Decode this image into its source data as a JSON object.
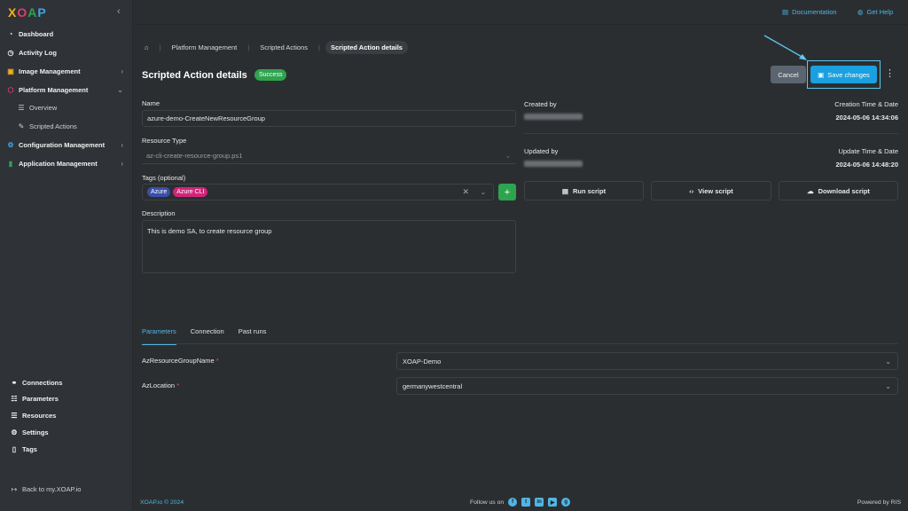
{
  "app": {
    "logo_text": "XOAP"
  },
  "topbar": {
    "documentation": "Documentation",
    "get_help": "Get Help"
  },
  "sidebar": {
    "items": [
      {
        "label": "Dashboard",
        "icon": "dashboard-icon"
      },
      {
        "label": "Activity Log",
        "icon": "clock-icon"
      },
      {
        "label": "Image Management",
        "icon": "image-icon"
      },
      {
        "label": "Platform Management",
        "icon": "platform-icon"
      },
      {
        "label": "Overview",
        "icon": "list-icon"
      },
      {
        "label": "Scripted Actions",
        "icon": "script-icon"
      },
      {
        "label": "Configuration Management",
        "icon": "config-icon"
      },
      {
        "label": "Application Management",
        "icon": "chart-icon"
      }
    ],
    "bottom": [
      {
        "label": "Connections",
        "icon": "link-icon"
      },
      {
        "label": "Parameters",
        "icon": "parameters-icon"
      },
      {
        "label": "Resources",
        "icon": "resources-icon"
      },
      {
        "label": "Settings",
        "icon": "gear-icon"
      },
      {
        "label": "Tags",
        "icon": "bookmark-icon"
      }
    ],
    "back": "Back to my.XOAP.io"
  },
  "breadcrumb": [
    "Platform Management",
    "Scripted Actions",
    "Scripted Action details"
  ],
  "header": {
    "title": "Scripted Action details",
    "status": "Success",
    "cancel": "Cancel",
    "save": "Save changes"
  },
  "form": {
    "name_label": "Name",
    "name_value": "azure-demo-CreateNewResourceGroup",
    "resource_type_label": "Resource Type",
    "resource_type_value": "az-cli-create-resource-group.ps1",
    "tags_label": "Tags (optional)",
    "tags": [
      "Azure",
      "Azure CLI"
    ],
    "description_label": "Description",
    "description_value": "This is demo SA, to create resource group"
  },
  "info": {
    "created_by_label": "Created by",
    "creation_time_label": "Creation Time & Date",
    "creation_time": "2024-05-06 14:34:06",
    "updated_by_label": "Updated by",
    "update_time_label": "Update Time & Date",
    "update_time": "2024-05-06 14:48:20"
  },
  "actions": {
    "run": "Run script",
    "view": "View script",
    "download": "Download script"
  },
  "tabs": [
    "Parameters",
    "Connection",
    "Past runs"
  ],
  "params": [
    {
      "name": "AzResourceGroupName",
      "value": "XOAP-Demo"
    },
    {
      "name": "AzLocation",
      "value": "germanywestcentral"
    }
  ],
  "footer": {
    "copyright": "XOAP.io © 2024",
    "follow": "Follow us on",
    "powered": "Powered by RIS"
  },
  "colors": {
    "accent": "#1aa0e0",
    "success": "#2ea44f",
    "tag_azure": "#3b4fa8",
    "tag_cli": "#d2247a"
  }
}
